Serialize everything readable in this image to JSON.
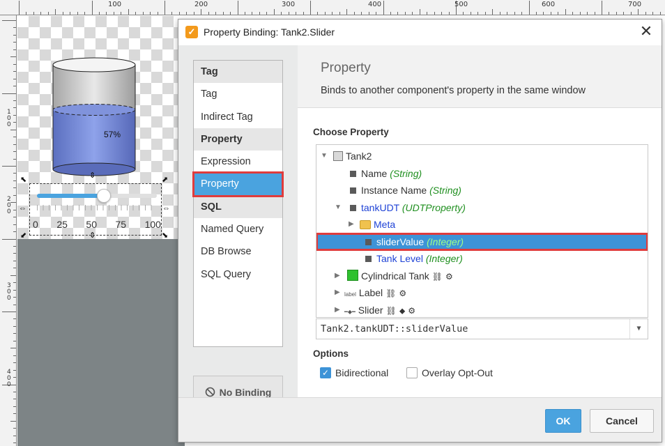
{
  "designer": {
    "ruler_top_labels": [
      "100",
      "200",
      "300",
      "400",
      "500",
      "600",
      "700"
    ],
    "ruler_left_labels": [
      "1\n0\n0",
      "2\n0\n0",
      "3\n0\n0",
      "4\n0\n0"
    ],
    "tank_percent": "57%",
    "tank_level_fraction": 0.57,
    "slider": {
      "value_fraction": 0.56,
      "tick_labels": [
        "0",
        "25",
        "50",
        "75",
        "100"
      ]
    }
  },
  "dialog": {
    "title": "Property Binding: Tank2.Slider",
    "close_glyph": "✕",
    "binding_types": [
      {
        "label": "Tag",
        "kind": "header"
      },
      {
        "label": "Tag",
        "kind": "item"
      },
      {
        "label": "Indirect Tag",
        "kind": "item"
      },
      {
        "label": "Property",
        "kind": "header"
      },
      {
        "label": "Expression",
        "kind": "item"
      },
      {
        "label": "Property",
        "kind": "selected"
      },
      {
        "label": "SQL",
        "kind": "header"
      },
      {
        "label": "Named Query",
        "kind": "item"
      },
      {
        "label": "DB Browse",
        "kind": "item"
      },
      {
        "label": "SQL Query",
        "kind": "item"
      }
    ],
    "no_binding_label": "No Binding",
    "section_title": "Property",
    "section_description": "Binds to another component's property in the same window",
    "choose_property_label": "Choose Property",
    "tree": [
      {
        "name": "Tank2",
        "type": "",
        "icon": "component-icon",
        "expanded": true
      },
      {
        "name": "Name",
        "type": "(String)",
        "icon": "property-icon"
      },
      {
        "name": "Instance Name",
        "type": "(String)",
        "icon": "property-icon"
      },
      {
        "name": "tankUDT",
        "type": "(UDTProperty)",
        "icon": "property-icon",
        "expanded": true
      },
      {
        "name": "Meta",
        "type": "",
        "icon": "folder-icon"
      },
      {
        "name": "sliderValue",
        "type": "(Integer)",
        "icon": "property-icon",
        "selected": true
      },
      {
        "name": "Tank Level",
        "type": "(Integer)",
        "icon": "property-icon"
      },
      {
        "name": "Cylindrical Tank",
        "type": "",
        "icon": "tank-icon"
      },
      {
        "name": "Label",
        "type": "",
        "icon": "label-icon"
      },
      {
        "name": "Slider",
        "type": "",
        "icon": "slider-icon"
      }
    ],
    "tree_icon_glyphs": {
      "label_icon": "label",
      "link": "⛓",
      "tag": "⬥",
      "settings": "⚙"
    },
    "property_path": "Tank2.tankUDT::sliderValue",
    "options_label": "Options",
    "options": [
      {
        "label": "Bidirectional",
        "checked": true
      },
      {
        "label": "Overlay Opt-Out",
        "checked": false
      }
    ],
    "ok_label": "OK",
    "cancel_label": "Cancel"
  }
}
